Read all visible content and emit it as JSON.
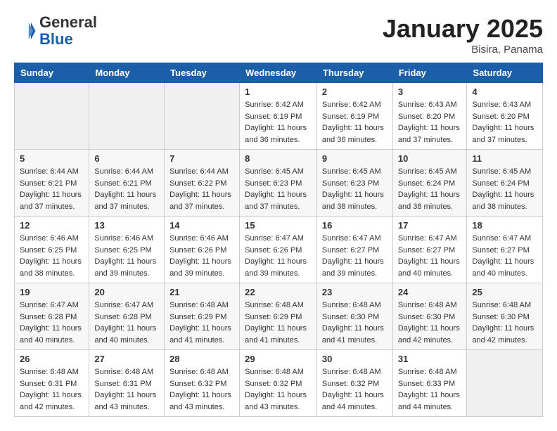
{
  "header": {
    "logo_line1": "General",
    "logo_line2": "Blue",
    "month_title": "January 2025",
    "subtitle": "Bisira, Panama"
  },
  "weekdays": [
    "Sunday",
    "Monday",
    "Tuesday",
    "Wednesday",
    "Thursday",
    "Friday",
    "Saturday"
  ],
  "weeks": [
    [
      {
        "day": "",
        "info": ""
      },
      {
        "day": "",
        "info": ""
      },
      {
        "day": "",
        "info": ""
      },
      {
        "day": "1",
        "info": "Sunrise: 6:42 AM\nSunset: 6:19 PM\nDaylight: 11 hours and 36 minutes."
      },
      {
        "day": "2",
        "info": "Sunrise: 6:42 AM\nSunset: 6:19 PM\nDaylight: 11 hours and 36 minutes."
      },
      {
        "day": "3",
        "info": "Sunrise: 6:43 AM\nSunset: 6:20 PM\nDaylight: 11 hours and 37 minutes."
      },
      {
        "day": "4",
        "info": "Sunrise: 6:43 AM\nSunset: 6:20 PM\nDaylight: 11 hours and 37 minutes."
      }
    ],
    [
      {
        "day": "5",
        "info": "Sunrise: 6:44 AM\nSunset: 6:21 PM\nDaylight: 11 hours and 37 minutes."
      },
      {
        "day": "6",
        "info": "Sunrise: 6:44 AM\nSunset: 6:21 PM\nDaylight: 11 hours and 37 minutes."
      },
      {
        "day": "7",
        "info": "Sunrise: 6:44 AM\nSunset: 6:22 PM\nDaylight: 11 hours and 37 minutes."
      },
      {
        "day": "8",
        "info": "Sunrise: 6:45 AM\nSunset: 6:23 PM\nDaylight: 11 hours and 37 minutes."
      },
      {
        "day": "9",
        "info": "Sunrise: 6:45 AM\nSunset: 6:23 PM\nDaylight: 11 hours and 38 minutes."
      },
      {
        "day": "10",
        "info": "Sunrise: 6:45 AM\nSunset: 6:24 PM\nDaylight: 11 hours and 38 minutes."
      },
      {
        "day": "11",
        "info": "Sunrise: 6:45 AM\nSunset: 6:24 PM\nDaylight: 11 hours and 38 minutes."
      }
    ],
    [
      {
        "day": "12",
        "info": "Sunrise: 6:46 AM\nSunset: 6:25 PM\nDaylight: 11 hours and 38 minutes."
      },
      {
        "day": "13",
        "info": "Sunrise: 6:46 AM\nSunset: 6:25 PM\nDaylight: 11 hours and 39 minutes."
      },
      {
        "day": "14",
        "info": "Sunrise: 6:46 AM\nSunset: 6:26 PM\nDaylight: 11 hours and 39 minutes."
      },
      {
        "day": "15",
        "info": "Sunrise: 6:47 AM\nSunset: 6:26 PM\nDaylight: 11 hours and 39 minutes."
      },
      {
        "day": "16",
        "info": "Sunrise: 6:47 AM\nSunset: 6:27 PM\nDaylight: 11 hours and 39 minutes."
      },
      {
        "day": "17",
        "info": "Sunrise: 6:47 AM\nSunset: 6:27 PM\nDaylight: 11 hours and 40 minutes."
      },
      {
        "day": "18",
        "info": "Sunrise: 6:47 AM\nSunset: 6:27 PM\nDaylight: 11 hours and 40 minutes."
      }
    ],
    [
      {
        "day": "19",
        "info": "Sunrise: 6:47 AM\nSunset: 6:28 PM\nDaylight: 11 hours and 40 minutes."
      },
      {
        "day": "20",
        "info": "Sunrise: 6:47 AM\nSunset: 6:28 PM\nDaylight: 11 hours and 40 minutes."
      },
      {
        "day": "21",
        "info": "Sunrise: 6:48 AM\nSunset: 6:29 PM\nDaylight: 11 hours and 41 minutes."
      },
      {
        "day": "22",
        "info": "Sunrise: 6:48 AM\nSunset: 6:29 PM\nDaylight: 11 hours and 41 minutes."
      },
      {
        "day": "23",
        "info": "Sunrise: 6:48 AM\nSunset: 6:30 PM\nDaylight: 11 hours and 41 minutes."
      },
      {
        "day": "24",
        "info": "Sunrise: 6:48 AM\nSunset: 6:30 PM\nDaylight: 11 hours and 42 minutes."
      },
      {
        "day": "25",
        "info": "Sunrise: 6:48 AM\nSunset: 6:30 PM\nDaylight: 11 hours and 42 minutes."
      }
    ],
    [
      {
        "day": "26",
        "info": "Sunrise: 6:48 AM\nSunset: 6:31 PM\nDaylight: 11 hours and 42 minutes."
      },
      {
        "day": "27",
        "info": "Sunrise: 6:48 AM\nSunset: 6:31 PM\nDaylight: 11 hours and 43 minutes."
      },
      {
        "day": "28",
        "info": "Sunrise: 6:48 AM\nSunset: 6:32 PM\nDaylight: 11 hours and 43 minutes."
      },
      {
        "day": "29",
        "info": "Sunrise: 6:48 AM\nSunset: 6:32 PM\nDaylight: 11 hours and 43 minutes."
      },
      {
        "day": "30",
        "info": "Sunrise: 6:48 AM\nSunset: 6:32 PM\nDaylight: 11 hours and 44 minutes."
      },
      {
        "day": "31",
        "info": "Sunrise: 6:48 AM\nSunset: 6:33 PM\nDaylight: 11 hours and 44 minutes."
      },
      {
        "day": "",
        "info": ""
      }
    ]
  ]
}
